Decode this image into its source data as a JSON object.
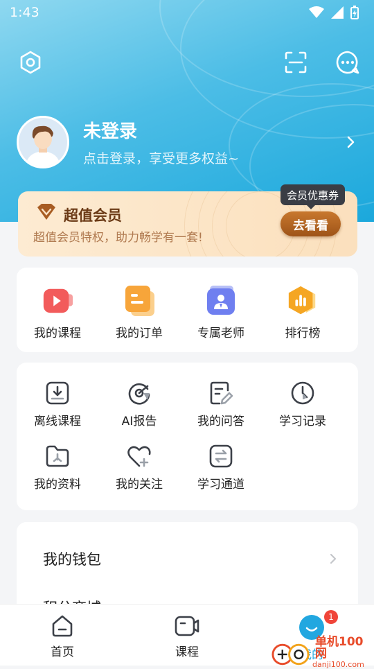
{
  "status_bar": {
    "time": "1:43"
  },
  "profile": {
    "name": "未登录",
    "subtitle": "点击登录，享受更多权益~"
  },
  "vip": {
    "title": "超值会员",
    "subtitle": "超值会员特权，助力畅学有一套!",
    "button": "去看看",
    "tooltip": "会员优惠券"
  },
  "quick": [
    {
      "label": "我的课程",
      "icon": "video-icon",
      "color": "#f15a5a"
    },
    {
      "label": "我的订单",
      "icon": "order-icon",
      "color": "#f7a53a"
    },
    {
      "label": "专属老师",
      "icon": "teacher-icon",
      "color": "#6c7cf0"
    },
    {
      "label": "排行榜",
      "icon": "ranking-icon",
      "color": "#f5a623"
    }
  ],
  "tools": [
    {
      "label": "离线课程",
      "icon": "download-icon"
    },
    {
      "label": "AI报告",
      "icon": "ai-report-icon"
    },
    {
      "label": "我的问答",
      "icon": "qa-icon"
    },
    {
      "label": "学习记录",
      "icon": "clock-icon"
    },
    {
      "label": "我的资料",
      "icon": "folder-icon"
    },
    {
      "label": "我的关注",
      "icon": "heart-icon"
    },
    {
      "label": "学习通道",
      "icon": "channel-icon"
    }
  ],
  "wallet": {
    "label": "我的钱包",
    "next_label": "积分商城"
  },
  "tabs": [
    {
      "label": "首页",
      "icon": "home-icon"
    },
    {
      "label": "课程",
      "icon": "course-video-icon"
    },
    {
      "label": "我的",
      "icon": "me-icon"
    }
  ],
  "badge": "1",
  "watermark": {
    "brand": "单机100网",
    "domain": "danji100.com"
  }
}
